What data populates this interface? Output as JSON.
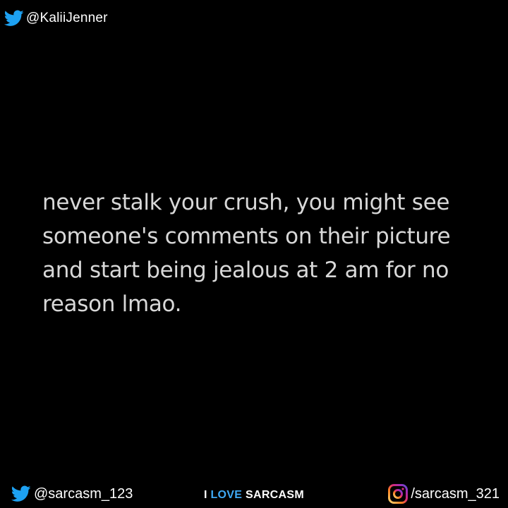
{
  "colors": {
    "background": "#000000",
    "quote_text": "#d8d8d8",
    "twitter_blue": "#1da1f2",
    "brand_accent": "#3fa9f5"
  },
  "header": {
    "icon": "twitter-bird-icon",
    "handle": "@KaliiJenner"
  },
  "quote": {
    "text": "never stalk your crush, you might see someone's comments on their picture and start being jealous at 2 am for no reason lmao."
  },
  "footer": {
    "twitter": {
      "icon": "twitter-bird-icon",
      "handle": "@sarcasm_123"
    },
    "brand": {
      "word1": "I",
      "word2": "LOVE",
      "word3": "SARCASM"
    },
    "instagram": {
      "icon": "instagram-icon",
      "handle": "/sarcasm_321"
    }
  }
}
